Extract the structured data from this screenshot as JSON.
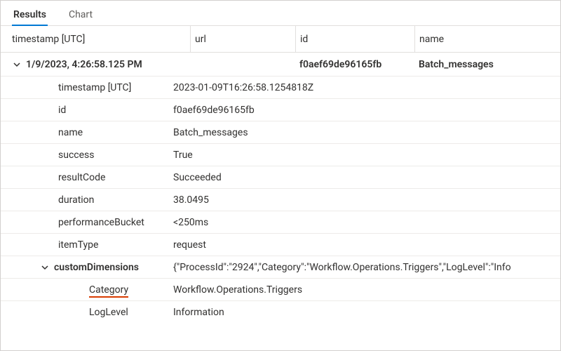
{
  "tabs": {
    "results": "Results",
    "chart": "Chart"
  },
  "columns": {
    "timestamp": "timestamp [UTC]",
    "url": "url",
    "id": "id",
    "name": "name"
  },
  "mainRow": {
    "timestamp": "1/9/2023, 4:26:58.125 PM",
    "url": "",
    "id": "f0aef69de96165fb",
    "name": "Batch_messages"
  },
  "details": {
    "timestamp_label": "timestamp [UTC]",
    "timestamp_value": "2023-01-09T16:26:58.1254818Z",
    "id_label": "id",
    "id_value": "f0aef69de96165fb",
    "name_label": "name",
    "name_value": "Batch_messages",
    "success_label": "success",
    "success_value": "True",
    "resultCode_label": "resultCode",
    "resultCode_value": "Succeeded",
    "duration_label": "duration",
    "duration_value": "38.0495",
    "performanceBucket_label": "performanceBucket",
    "performanceBucket_value": "<250ms",
    "itemType_label": "itemType",
    "itemType_value": "request",
    "customDimensions_label": "customDimensions",
    "customDimensions_value": "{\"ProcessId\":\"2924\",\"Category\":\"Workflow.Operations.Triggers\",\"LogLevel\":\"Info",
    "category_label": "Category",
    "category_value": "Workflow.Operations.Triggers",
    "loglevel_label": "LogLevel",
    "loglevel_value": "Information"
  }
}
